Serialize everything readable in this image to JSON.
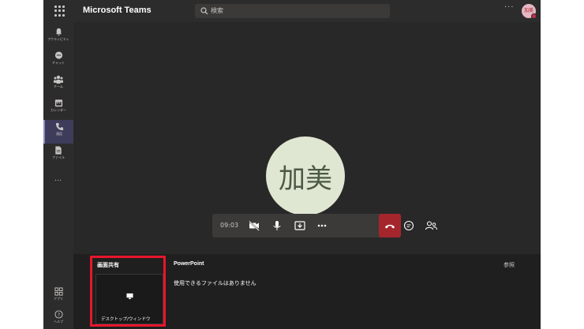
{
  "app": {
    "title": "Microsoft Teams"
  },
  "search": {
    "placeholder": "検索"
  },
  "user": {
    "avatar_initials": "加美"
  },
  "rail": {
    "items": [
      {
        "label": "アクティビティ",
        "icon": "bell-icon"
      },
      {
        "label": "チャット",
        "icon": "chat-icon"
      },
      {
        "label": "チーム",
        "icon": "teams-icon"
      },
      {
        "label": "カレンダー",
        "icon": "calendar-icon"
      },
      {
        "label": "通話",
        "icon": "phone-icon",
        "active": true
      },
      {
        "label": "ファイル",
        "icon": "file-icon"
      }
    ],
    "more": "…",
    "bottom": [
      {
        "label": "アプリ",
        "icon": "apps-icon"
      },
      {
        "label": "ヘルプ",
        "icon": "help-icon"
      }
    ]
  },
  "call": {
    "speaker_name": "加美",
    "timer": "09:03",
    "colors": {
      "hangup": "#a4262c",
      "avatar_bg": "#dfe6d2"
    }
  },
  "tray": {
    "screen_share_title": "画面共有",
    "powerpoint_title": "PowerPoint",
    "browse_label": "参照",
    "empty_message": "使用できるファイルはありません",
    "desktop_window_label": "デスクトップ/ウィンドウ"
  },
  "highlight_color": "#e8162b"
}
